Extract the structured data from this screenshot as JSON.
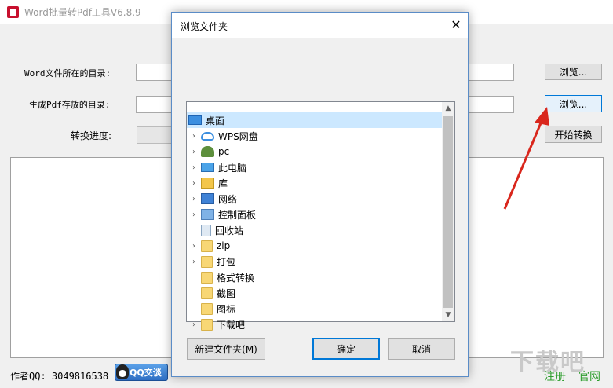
{
  "window": {
    "title": "Word批量转Pdf工具V6.8.9"
  },
  "form": {
    "word_dir_label": "Word文件所在的目录:",
    "pdf_dir_label": "生成Pdf存放的目录:",
    "progress_label": "转换进度:",
    "browse_label_1": "浏览...",
    "browse_label_2": "浏览...",
    "start_label": "开始转换"
  },
  "footer": {
    "author": "作者QQ: 3049816538",
    "qq_badge": "QQ交谈",
    "register": "注册",
    "official": "官网"
  },
  "watermark": "下载吧",
  "dialog": {
    "title": "浏览文件夹",
    "close": "✕",
    "tree": [
      {
        "label": "桌面",
        "icon": "desktop-icon",
        "expand": false,
        "indent": 0,
        "selected": true
      },
      {
        "label": "WPS网盘",
        "icon": "cloud-icon",
        "expand": true,
        "indent": 1
      },
      {
        "label": "pc",
        "icon": "user-icon",
        "expand": true,
        "indent": 1
      },
      {
        "label": "此电脑",
        "icon": "computer-icon",
        "expand": true,
        "indent": 1
      },
      {
        "label": "库",
        "icon": "library-icon",
        "expand": true,
        "indent": 1
      },
      {
        "label": "网络",
        "icon": "network-icon",
        "expand": true,
        "indent": 1
      },
      {
        "label": "控制面板",
        "icon": "control-panel-icon",
        "expand": true,
        "indent": 1
      },
      {
        "label": "回收站",
        "icon": "recycle-bin-icon",
        "expand": false,
        "indent": 1
      },
      {
        "label": "zip",
        "icon": "folder-icon",
        "expand": true,
        "indent": 1
      },
      {
        "label": "打包",
        "icon": "folder-icon",
        "expand": true,
        "indent": 1
      },
      {
        "label": "格式转换",
        "icon": "folder-icon",
        "expand": false,
        "indent": 1
      },
      {
        "label": "截图",
        "icon": "folder-icon",
        "expand": false,
        "indent": 1
      },
      {
        "label": "图标",
        "icon": "folder-icon",
        "expand": false,
        "indent": 1
      },
      {
        "label": "下载吧",
        "icon": "folder-icon",
        "expand": true,
        "indent": 1
      }
    ],
    "new_folder": "新建文件夹(M)",
    "ok": "确定",
    "cancel": "取消"
  },
  "colors": {
    "accent": "#0078d7",
    "arrow": "#d9261c",
    "selection": "#cce8ff"
  }
}
